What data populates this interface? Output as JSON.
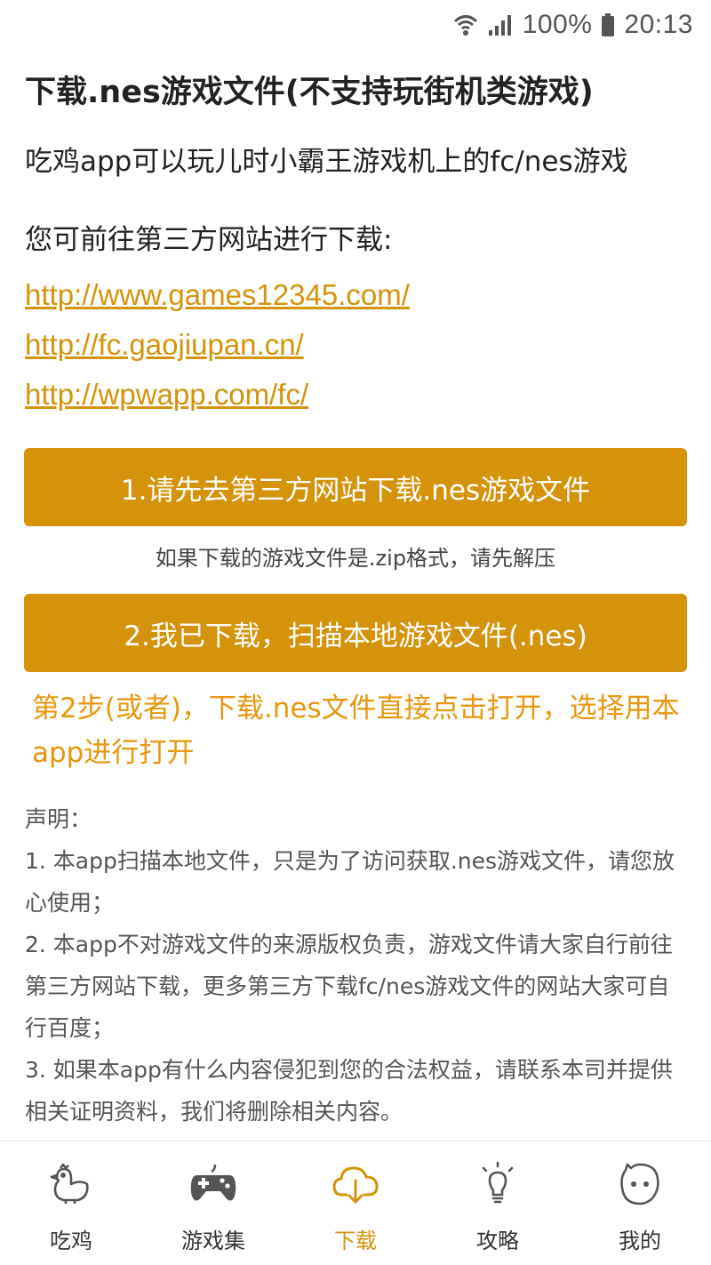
{
  "status_bar": {
    "battery_percent": "100%",
    "time": "20:13"
  },
  "page": {
    "title": "下载.nes游戏文件(不支持玩街机类游戏)",
    "intro": "吃鸡app可以玩儿时小霸王游戏机上的fc/nes游戏",
    "site_prompt": "您可前往第三方网站进行下载:",
    "links": [
      "http://www.games12345.com/",
      "http://fc.gaojiupan.cn/",
      "http://wpwapp.com/fc/"
    ],
    "step1_button": "1.请先去第三方网站下载.nes游戏文件",
    "zip_note": "如果下载的游戏文件是.zip格式，请先解压",
    "step2_button": "2.我已下载，扫描本地游戏文件(.nes)",
    "step2_alt": "第2步(或者)，下载.nes文件直接点击打开，选择用本app进行打开",
    "disclaimer": {
      "heading": "声明：",
      "items": [
        "1. 本app扫描本地文件，只是为了访问获取.nes游戏文件，请您放心使用；",
        "2. 本app不对游戏文件的来源版权负责，游戏文件请大家自行前往第三方网站下载，更多第三方下载fc/nes游戏文件的网站大家可自行百度；",
        "3. 如果本app有什么内容侵犯到您的合法权益，请联系本司并提供相关证明资料，我们将删除相关内容。"
      ]
    }
  },
  "bottom_nav": {
    "items": [
      {
        "label": "吃鸡",
        "icon": "chicken-icon",
        "active": false
      },
      {
        "label": "游戏集",
        "icon": "gamepad-icon",
        "active": false
      },
      {
        "label": "下载",
        "icon": "cloud-download-icon",
        "active": true
      },
      {
        "label": "攻略",
        "icon": "lightbulb-icon",
        "active": false
      },
      {
        "label": "我的",
        "icon": "face-icon",
        "active": false
      }
    ]
  },
  "colors": {
    "accent": "#d4930a",
    "alt_text": "#e8960c",
    "inactive_icon": "#555555"
  }
}
